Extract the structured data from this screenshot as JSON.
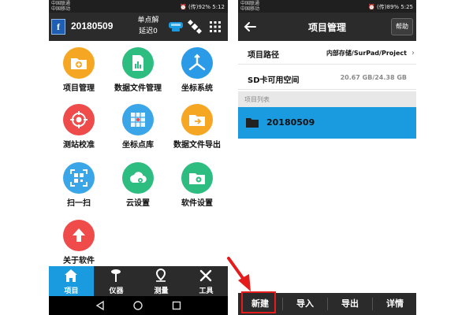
{
  "left_screen": {
    "status": {
      "carrier_line1": "中国联通",
      "carrier_line2": "中国移动",
      "right": "⏰ (传)92% 5:12"
    },
    "appbar": {
      "logo_letter": "f",
      "project_name": "20180509",
      "mode_line1": "单点解",
      "mode_line2": "延迟0"
    },
    "tiles": [
      {
        "label": "项目管理",
        "icon": "folder-add-icon",
        "color": "#f5a623"
      },
      {
        "label": "数据文件管理",
        "icon": "data-file-icon",
        "color": "#2dbd80"
      },
      {
        "label": "坐标系统",
        "icon": "coordinate-axes-icon",
        "color": "#2b9be8"
      },
      {
        "label": "测站校准",
        "icon": "target-icon",
        "color": "#ef4b4b"
      },
      {
        "label": "坐标点库",
        "icon": "point-grid-icon",
        "color": "#3aa6e8"
      },
      {
        "label": "数据文件导出",
        "icon": "folder-export-icon",
        "color": "#f5a623"
      },
      {
        "label": "扫一扫",
        "icon": "qr-scan-icon",
        "color": "#3aa6e8"
      },
      {
        "label": "云设置",
        "icon": "cloud-settings-icon",
        "color": "#2dbd80"
      },
      {
        "label": "软件设置",
        "icon": "folder-settings-icon",
        "color": "#2dbd80"
      },
      {
        "label": "关于软件",
        "icon": "upload-arrow-icon",
        "color": "#ef4b4b"
      }
    ],
    "tabs": [
      {
        "label": "项目",
        "icon": "home-icon",
        "active": true
      },
      {
        "label": "仪器",
        "icon": "instrument-icon",
        "active": false
      },
      {
        "label": "测量",
        "icon": "location-pin-icon",
        "active": false
      },
      {
        "label": "工具",
        "icon": "tools-icon",
        "active": false
      }
    ]
  },
  "right_screen": {
    "status": {
      "carrier_line1": "中国联通",
      "carrier_line2": "中国移动",
      "right": "⏰ (传)89% 5:25"
    },
    "appbar": {
      "title": "项目管理",
      "help_label": "帮助"
    },
    "rows": {
      "path_label": "项目路径",
      "path_value": "内部存储/SurPad/Project",
      "sd_label": "SD卡可用空间",
      "sd_value": "20.67 GB/24.38 GB"
    },
    "list_header": "项目列表",
    "projects": [
      "20180509"
    ],
    "buttons": [
      "新建",
      "导入",
      "导出",
      "详情"
    ]
  },
  "colors": {
    "accent": "#1a9be0",
    "highlight": "#e51c1c",
    "bar": "#2b2b2b"
  }
}
